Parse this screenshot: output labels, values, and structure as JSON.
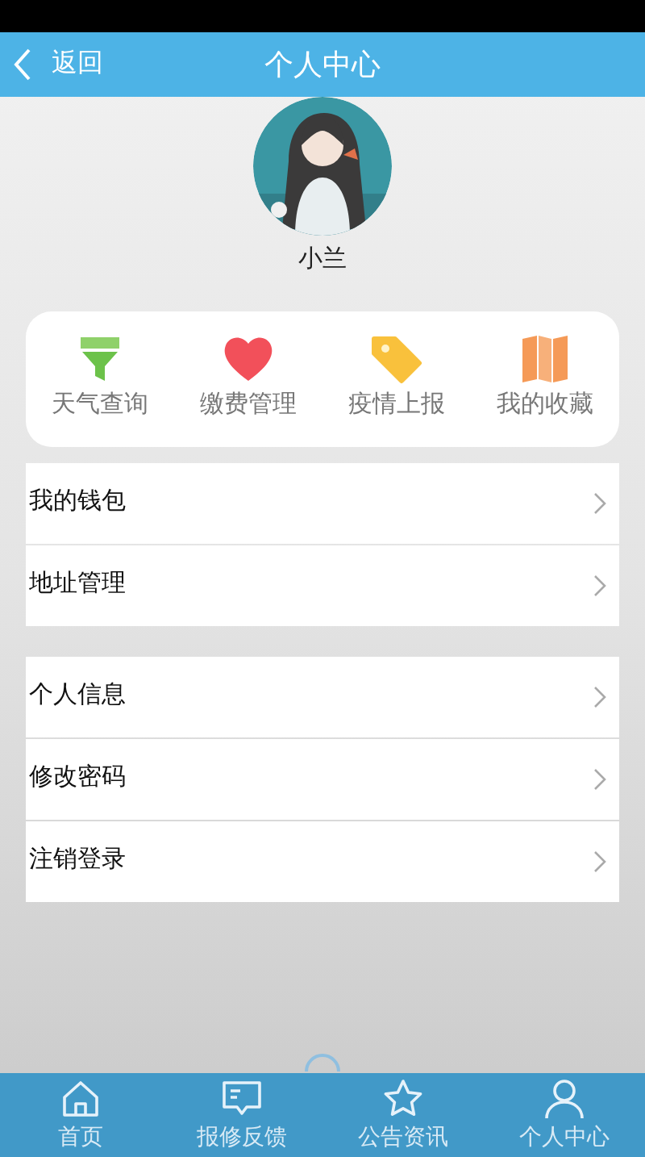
{
  "header": {
    "back_label": "返回",
    "title": "个人中心"
  },
  "profile": {
    "name": "小兰"
  },
  "shortcuts": [
    {
      "label": "天气查询",
      "kind": "funnel"
    },
    {
      "label": "缴费管理",
      "kind": "heart"
    },
    {
      "label": "疫情上报",
      "kind": "tag"
    },
    {
      "label": "我的收藏",
      "kind": "map"
    }
  ],
  "menu_groups": [
    [
      "我的钱包",
      "地址管理"
    ],
    [
      "个人信息",
      "修改密码",
      "注销登录"
    ]
  ],
  "tab_bar": [
    {
      "label": "首页",
      "kind": "home"
    },
    {
      "label": "报修反馈",
      "kind": "message"
    },
    {
      "label": "公告资讯",
      "kind": "star"
    },
    {
      "label": "个人中心",
      "kind": "user"
    }
  ]
}
